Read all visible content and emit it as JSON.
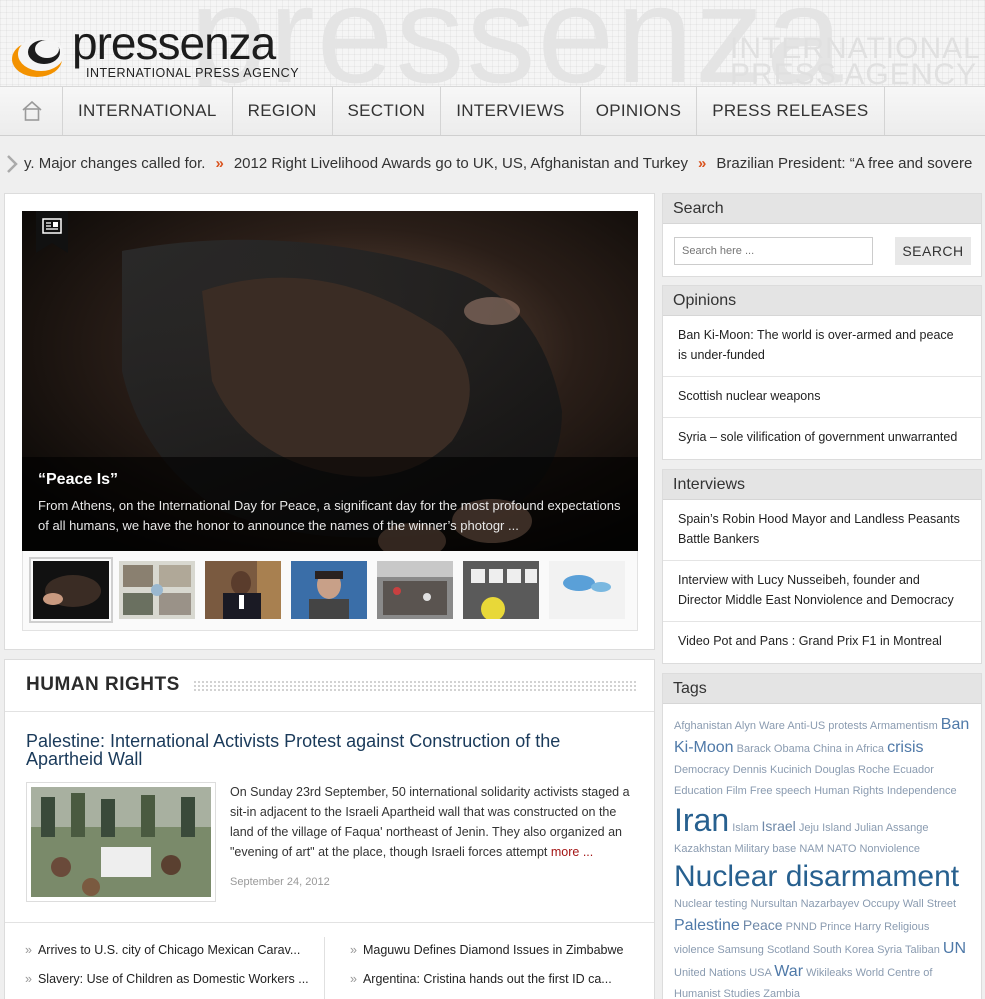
{
  "header": {
    "watermark": "pressenza",
    "watermark_sub_1": "INTERNATIONAL",
    "watermark_sub_2": "PRESS AGENCY",
    "logo_word": "pressenza",
    "logo_tagline": "INTERNATIONAL PRESS AGENCY",
    "colors": {
      "logo_orange": "#f39200",
      "logo_dark": "#1c1c1c"
    }
  },
  "nav": {
    "home_icon": "home-icon",
    "items": [
      {
        "label": "INTERNATIONAL"
      },
      {
        "label": "REGION"
      },
      {
        "label": "SECTION"
      },
      {
        "label": "INTERVIEWS"
      },
      {
        "label": "OPINIONS"
      },
      {
        "label": "PRESS RELEASES"
      }
    ]
  },
  "ticker": {
    "items": [
      "y. Major changes called for.",
      "2012 Right Livelihood Awards go to UK, US, Afghanistan and Turkey",
      "Brazilian President: “A free and sovereign"
    ],
    "separator": "»",
    "accent": "#d9531e"
  },
  "slider": {
    "badge_icon": "article-icon",
    "title": "“Peace Is”",
    "text": "From Athens, on the International Day for Peace, a significant day for the most profound expectations of all humans, we have the honor to announce the names of the winner’s photogr ...",
    "thumbnail_count": 7
  },
  "human_rights": {
    "title": "HUMAN RIGHTS",
    "article": {
      "title": "Palestine: International Activists Protest against Construction of the Apartheid Wall",
      "text": "On Sunday 23rd September, 50 international solidarity activists staged a sit-in adjacent to the Israeli Apartheid wall that was constructed on the land of the village of Faqua' northeast of Jenin. They also organized an \"evening of art\" at the place, though Israeli forces attempt",
      "more": "more ...",
      "date": "September 24, 2012"
    },
    "related_left": [
      "Arrives to U.S. city of Chicago Mexican Carav...",
      "Slavery: Use of Children as Domestic Workers ..."
    ],
    "related_right": [
      "Maguwu Defines Diamond Issues in Zimbabwe",
      "Argentina: Cristina hands out the first ID ca..."
    ],
    "bullet": "»"
  },
  "sidebar": {
    "search": {
      "title": "Search",
      "placeholder": "Search here ...",
      "button": "SEARCH"
    },
    "opinions": {
      "title": "Opinions",
      "items": [
        "Ban Ki-Moon: The world is over-armed and peace is under-funded",
        "Scottish nuclear weapons",
        "Syria – sole vilification of government unwarranted"
      ]
    },
    "interviews": {
      "title": "Interviews",
      "items": [
        "Spain’s Robin Hood Mayor and Landless Peasants Battle Bankers",
        "Interview with Lucy Nusseibeh, founder and Director Middle East Nonviolence and Democracy",
        "Video Pot and Pans : Grand Prix F1 in Montreal"
      ]
    },
    "tags": {
      "title": "Tags",
      "items": [
        {
          "label": "Afghanistan",
          "size": 1
        },
        {
          "label": "Alyn Ware",
          "size": 1
        },
        {
          "label": "Anti-US protests",
          "size": 1
        },
        {
          "label": "Armamentism",
          "size": 1
        },
        {
          "label": "Ban Ki-Moon",
          "size": 3
        },
        {
          "label": "Barack Obama",
          "size": 1
        },
        {
          "label": "China",
          "size": 1
        },
        {
          "label": "in Africa",
          "size": 1
        },
        {
          "label": "crisis",
          "size": 3
        },
        {
          "label": "Democracy",
          "size": 1
        },
        {
          "label": "Dennis Kucinich",
          "size": 1
        },
        {
          "label": "Douglas Roche",
          "size": 1
        },
        {
          "label": "Ecuador",
          "size": 1
        },
        {
          "label": "Education",
          "size": 1
        },
        {
          "label": "Film",
          "size": 1
        },
        {
          "label": "Free speech",
          "size": 1
        },
        {
          "label": "Human Rights",
          "size": 1
        },
        {
          "label": "Independence",
          "size": 1
        },
        {
          "label": "Iran",
          "size": 4
        },
        {
          "label": "Islam",
          "size": 1
        },
        {
          "label": "Israel",
          "size": 2
        },
        {
          "label": "Jeju Island",
          "size": 1
        },
        {
          "label": "Julian Assange",
          "size": 1
        },
        {
          "label": "Kazakhstan",
          "size": 1
        },
        {
          "label": "Military base",
          "size": 1
        },
        {
          "label": "NAM",
          "size": 1
        },
        {
          "label": "NATO",
          "size": 1
        },
        {
          "label": "Nonviolence",
          "size": 1
        },
        {
          "label": "Nuclear disarmament",
          "size": 5
        },
        {
          "label": "Nuclear testing",
          "size": 1
        },
        {
          "label": "Nursultan Nazarbayev",
          "size": 1
        },
        {
          "label": "Occupy Wall Street",
          "size": 1
        },
        {
          "label": "Palestine",
          "size": 3
        },
        {
          "label": "Peace",
          "size": 2
        },
        {
          "label": "PNND",
          "size": 1
        },
        {
          "label": "Prince Harry",
          "size": 1
        },
        {
          "label": "Religious violence",
          "size": 1
        },
        {
          "label": "Samsung",
          "size": 1
        },
        {
          "label": "Scotland",
          "size": 1
        },
        {
          "label": "South Korea",
          "size": 1
        },
        {
          "label": "Syria",
          "size": 1
        },
        {
          "label": "Taliban",
          "size": 1
        },
        {
          "label": "UN",
          "size": 3
        },
        {
          "label": "United Nations",
          "size": 1
        },
        {
          "label": "USA",
          "size": 1
        },
        {
          "label": "War",
          "size": 3
        },
        {
          "label": "Wikileaks",
          "size": 1
        },
        {
          "label": "World Centre of Humanist Studies",
          "size": 1
        },
        {
          "label": "Zambia",
          "size": 1
        }
      ]
    }
  }
}
